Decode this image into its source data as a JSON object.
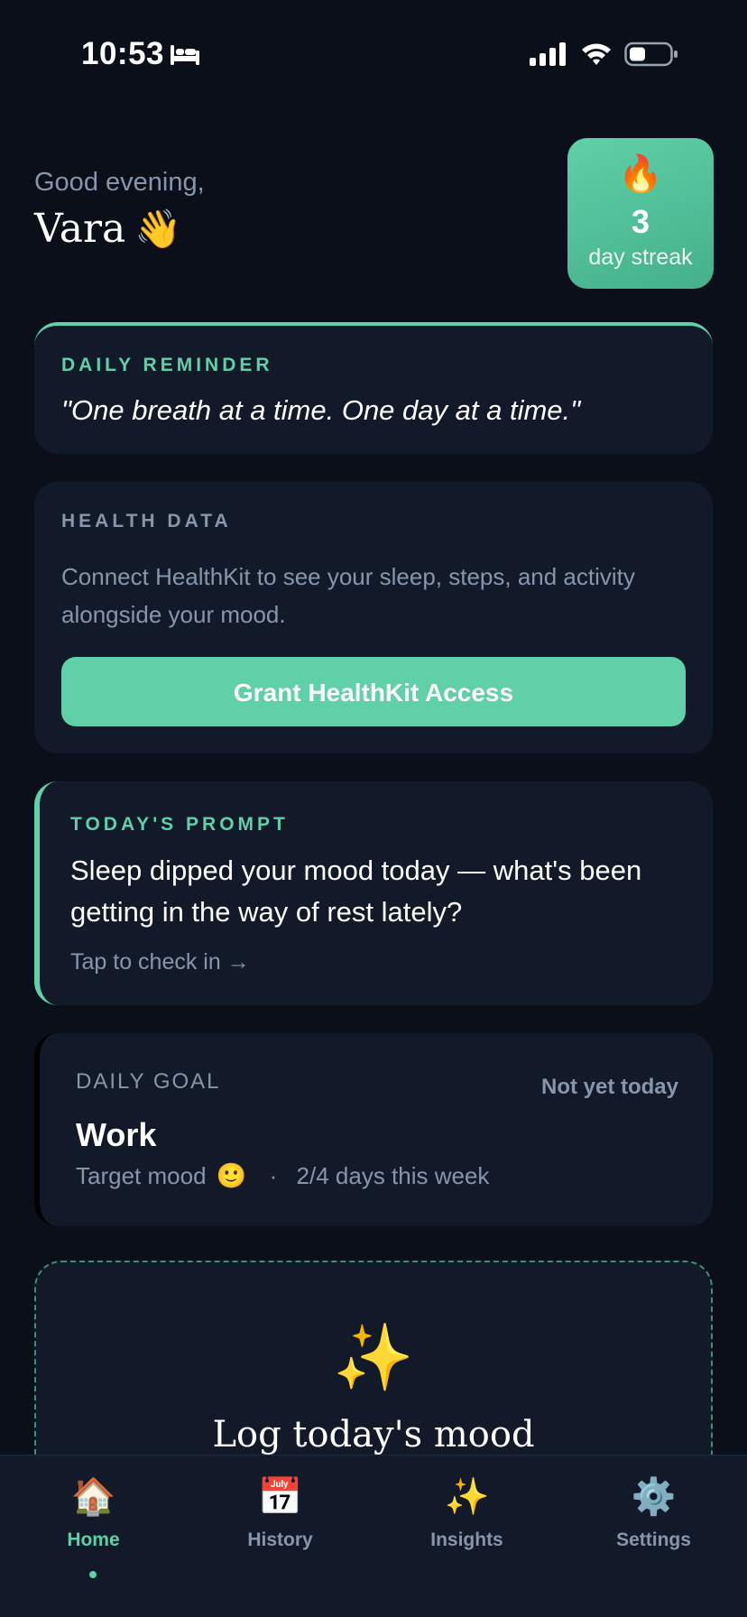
{
  "status_bar": {
    "time": "10:53",
    "icons": [
      "bed-icon",
      "signal-icon",
      "wifi-icon",
      "battery-icon"
    ]
  },
  "greeting": {
    "label": "Good evening,",
    "name": "Vara",
    "emoji": "👋"
  },
  "streak": {
    "emoji": "🔥",
    "count": "3",
    "label": "day streak"
  },
  "reminder": {
    "eyebrow": "DAILY REMINDER",
    "quote": "\"One breath at a time. One day at a time.\""
  },
  "health": {
    "eyebrow": "HEALTH DATA",
    "description": "Connect HealthKit to see your sleep, steps, and activity alongside your mood.",
    "button_label": "Grant HealthKit Access"
  },
  "prompt": {
    "eyebrow": "TODAY'S PROMPT",
    "text": "Sleep dipped your mood today — what's been getting in the way of rest lately?",
    "cta": "Tap to check in →"
  },
  "goal": {
    "label": "DAILY GOAL",
    "status": "Not yet today",
    "title": "Work",
    "target_label": "Target mood",
    "target_emoji": "🙂",
    "separator": "·",
    "progress": "2/4 days this week"
  },
  "log_mood": {
    "emoji": "✨",
    "title": "Log today's mood"
  },
  "tabs": [
    {
      "label": "Home",
      "icon": "🏠",
      "active": true
    },
    {
      "label": "History",
      "icon": "📅",
      "active": false
    },
    {
      "label": "Insights",
      "icon": "✨",
      "active": false
    },
    {
      "label": "Settings",
      "icon": "⚙️",
      "active": false
    }
  ],
  "colors": {
    "background": "#0a0f1a",
    "card": "#121a2a",
    "accent": "#5fd0a8",
    "muted_text": "#8896ab"
  }
}
